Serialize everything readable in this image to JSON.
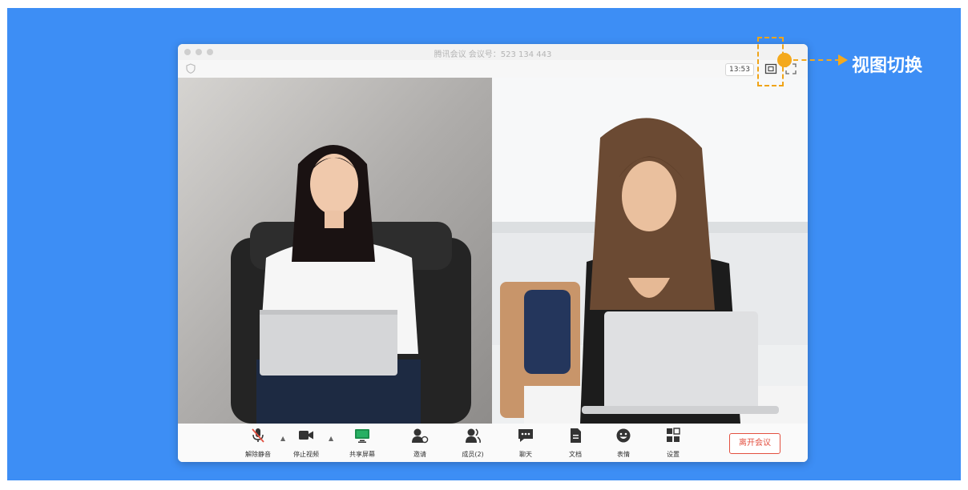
{
  "window": {
    "title": "腾讯会议 会议号：523 134 443",
    "time": "13:53"
  },
  "toolbar": {
    "unmute": "解除静音",
    "stop_video": "停止视频",
    "share_screen": "共享屏幕",
    "invite": "邀请",
    "members": "成员(2)",
    "chat": "聊天",
    "docs": "文档",
    "emoji": "表情",
    "settings": "设置",
    "leave": "离开会议"
  },
  "annotation": {
    "label": "视图切换",
    "color": "#f4a91d"
  },
  "colors": {
    "background": "#3d8ef5",
    "leave_accent": "#e35040"
  }
}
